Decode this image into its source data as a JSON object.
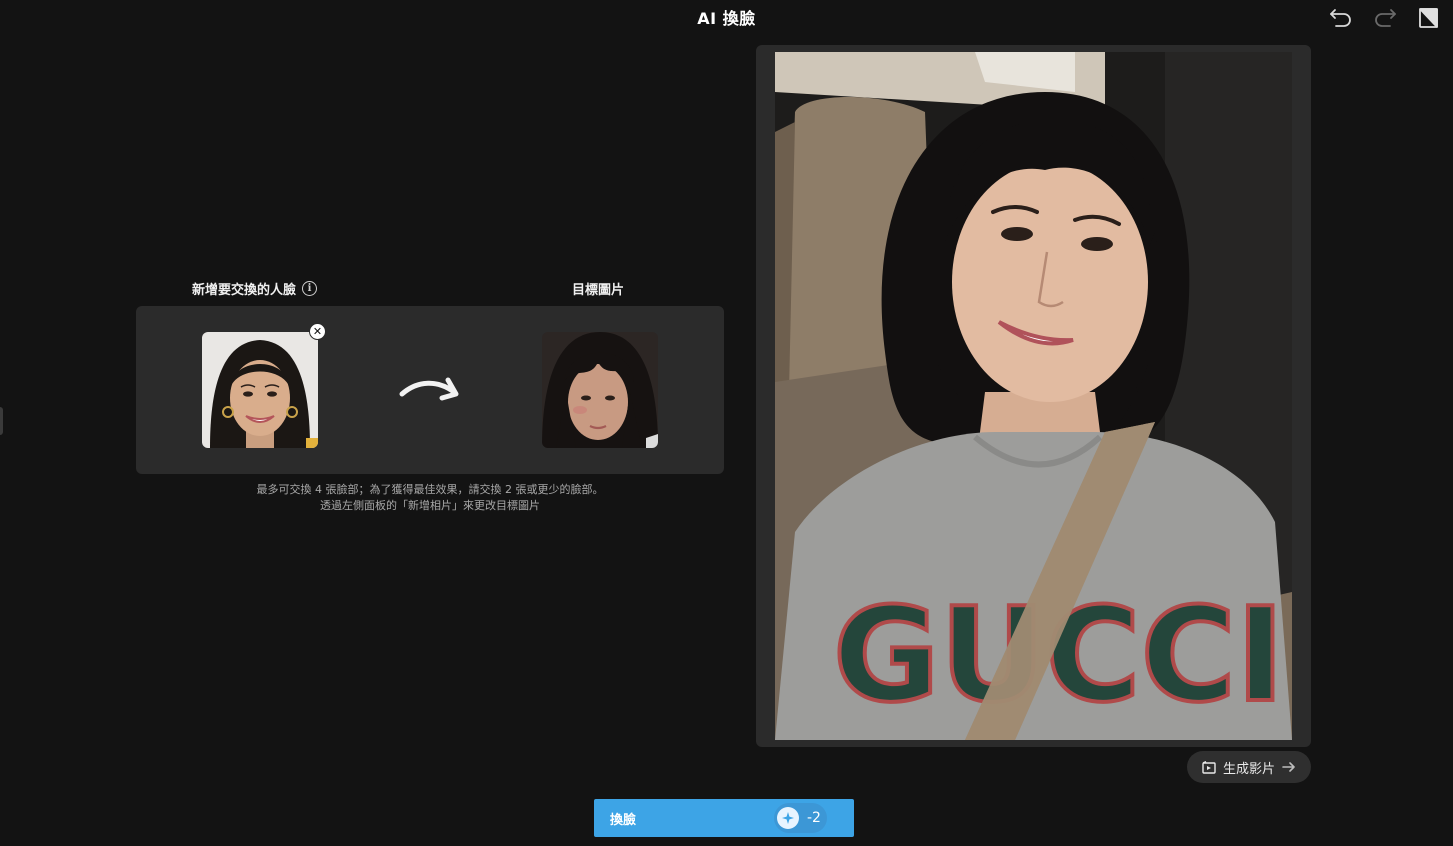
{
  "app": {
    "title": "AI 換臉"
  },
  "toolbar": {
    "undo_icon": "undo-icon",
    "redo_icon": "redo-icon",
    "compare_icon": "compare-icon"
  },
  "swap": {
    "face_label": "新增要交換的人臉",
    "target_label": "目標圖片",
    "hint_line1": "最多可交換 4 張臉部；為了獲得最佳效果，請交換 2 張或更少的臉部。",
    "hint_line2": "透過左側面板的「新增相片」來更改目標圖片",
    "remove_symbol": "✕"
  },
  "preview": {
    "shirt_text": "GUCCI"
  },
  "actions": {
    "generate_video": "生成影片",
    "swap_button": "換臉",
    "credit_cost": "-2"
  },
  "colors": {
    "accent": "#3da4e6",
    "background": "#131313",
    "panel": "#2b2b2b"
  }
}
